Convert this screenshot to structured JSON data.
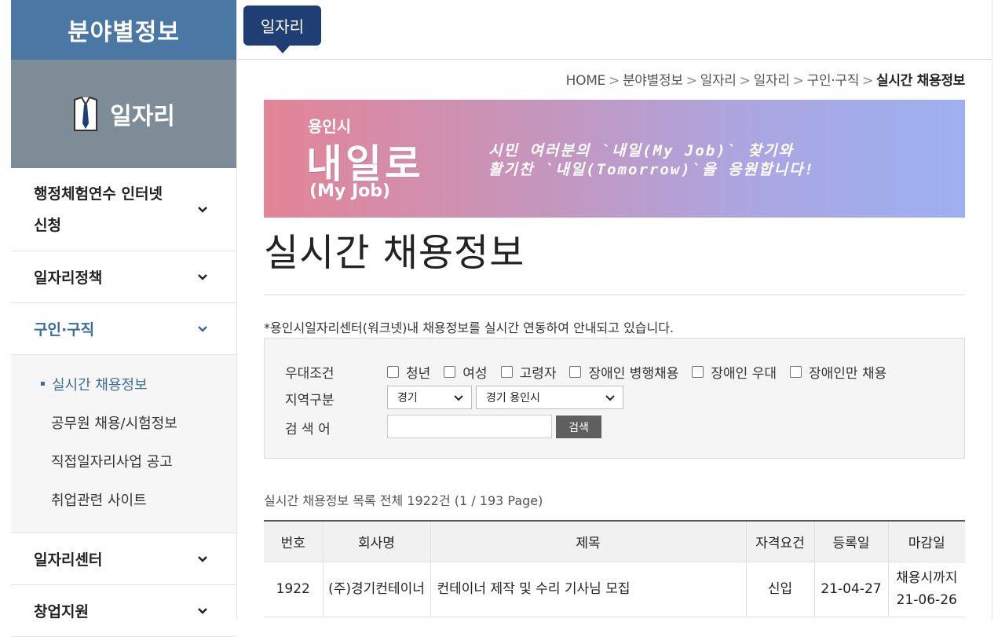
{
  "sidebar": {
    "header": "분야별정보",
    "category": "일자리",
    "menu": [
      {
        "label": "행정체험연수 인터넷\n신청"
      },
      {
        "label": "일자리정책"
      },
      {
        "label": "구인·구직"
      },
      {
        "label": "일자리센터"
      },
      {
        "label": "창업지원"
      }
    ],
    "submenu": [
      {
        "label": "실시간 채용정보",
        "bullet": "▪"
      },
      {
        "label": "공무원 채용/시험정보"
      },
      {
        "label": "직접일자리사업 공고"
      },
      {
        "label": "취업관련 사이트"
      }
    ]
  },
  "topbar": {
    "tab": "일자리"
  },
  "breadcrumb": {
    "items": [
      "HOME",
      "분야별정보",
      "일자리",
      "일자리",
      "구인·구직"
    ],
    "sep": ">",
    "current": "실시간 채용정보"
  },
  "banner": {
    "small": "용인시",
    "big": "내일로",
    "sub": "(My Job)",
    "line1": "시민 여러분의 `내일(My Job)` 찾기와",
    "line2": "활기찬 `내일(Tomorrow)`을 응원합니다!"
  },
  "page_title": "실시간 채용정보",
  "notice": "*용인시일자리센터(워크넷)내 채용정보를 실시간 연동하여 안내되고 있습니다.",
  "search": {
    "cond_label": "우대조건",
    "options": [
      "청년",
      "여성",
      "고령자",
      "장애인 병행채용",
      "장애인 우대",
      "장애인만 채용"
    ],
    "region_label": "지역구분",
    "region1": "경기",
    "region2": "경기 용인시",
    "keyword_label": "검 색 어",
    "keyword_value": "",
    "button": "검색"
  },
  "list_info": "실시간 채용정보 목록 전체 1922건 (1 / 193 Page)",
  "table": {
    "headers": [
      "번호",
      "회사명",
      "제목",
      "자격요건",
      "등록일",
      "마감일"
    ],
    "rows": [
      {
        "no": "1922",
        "company": "(주)경기컨테이너",
        "title": "컨테이너 제작 및 수리 기사님 모집",
        "qual": "신입",
        "reg": "21-04-27",
        "deadline1": "채용시까지",
        "deadline2": "21-06-26"
      }
    ]
  }
}
